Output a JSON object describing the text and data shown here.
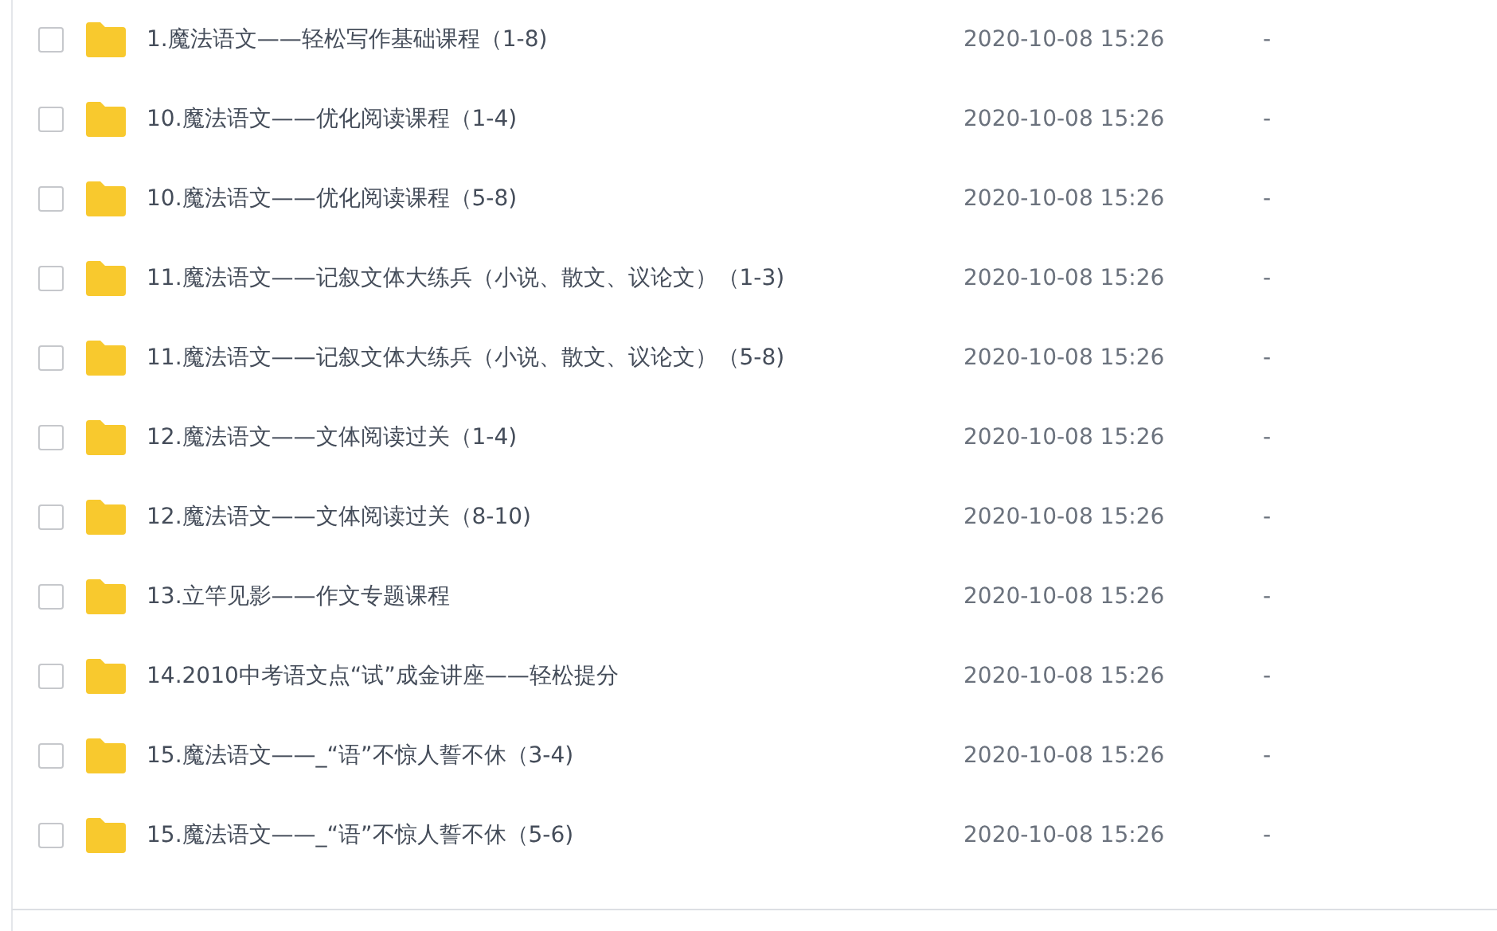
{
  "files": [
    {
      "name": "1.魔法语文——轻松写作基础课程（1-8)",
      "modified": "2020-10-08 15:26",
      "size": "-",
      "checked": false
    },
    {
      "name": "10.魔法语文——优化阅读课程（1-4)",
      "modified": "2020-10-08 15:26",
      "size": "-",
      "checked": false
    },
    {
      "name": "10.魔法语文——优化阅读课程（5-8)",
      "modified": "2020-10-08 15:26",
      "size": "-",
      "checked": false
    },
    {
      "name": "11.魔法语文——记叙文体大练兵（小说、散文、议论文）（1-3)",
      "modified": "2020-10-08 15:26",
      "size": "-",
      "checked": false
    },
    {
      "name": "11.魔法语文——记叙文体大练兵（小说、散文、议论文）（5-8)",
      "modified": "2020-10-08 15:26",
      "size": "-",
      "checked": false
    },
    {
      "name": "12.魔法语文——文体阅读过关（1-4)",
      "modified": "2020-10-08 15:26",
      "size": "-",
      "checked": false
    },
    {
      "name": "12.魔法语文——文体阅读过关（8-10)",
      "modified": "2020-10-08 15:26",
      "size": "-",
      "checked": false
    },
    {
      "name": "13.立竿见影——作文专题课程",
      "modified": "2020-10-08 15:26",
      "size": "-",
      "checked": false
    },
    {
      "name": "14.2010中考语文点“试”成金讲座——轻松提分",
      "modified": "2020-10-08 15:26",
      "size": "-",
      "checked": false
    },
    {
      "name": "15.魔法语文——_“语”不惊人誓不休（3-4)",
      "modified": "2020-10-08 15:26",
      "size": "-",
      "checked": false
    },
    {
      "name": "15.魔法语文——_“语”不惊人誓不休（5-6)",
      "modified": "2020-10-08 15:26",
      "size": "-",
      "checked": false
    }
  ]
}
